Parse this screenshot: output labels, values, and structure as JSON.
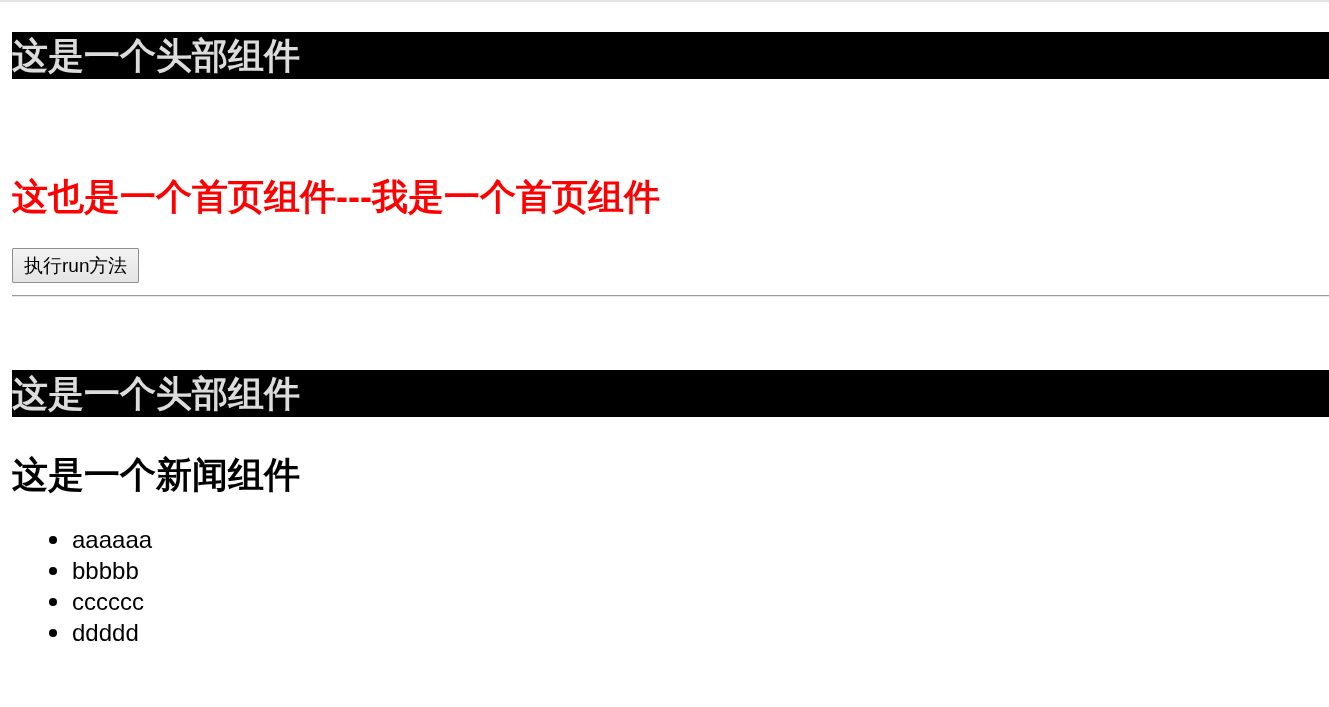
{
  "components": [
    {
      "kind": "header",
      "title": "这是一个头部组件"
    },
    {
      "kind": "home",
      "title": "这也是一个首页组件---我是一个首页组件",
      "button": "执行run方法"
    },
    {
      "kind": "header",
      "title": "这是一个头部组件"
    },
    {
      "kind": "news",
      "title": "这是一个新闻组件",
      "items": [
        "aaaaaa",
        "bbbbb",
        "cccccc",
        "ddddd"
      ]
    }
  ]
}
